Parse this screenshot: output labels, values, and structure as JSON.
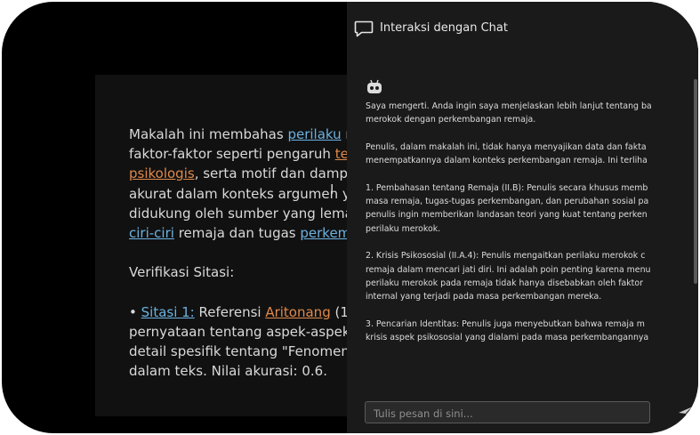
{
  "document": {
    "lines": [
      [
        {
          "t": "Makalah ini membahas ",
          "s": "plain"
        },
        {
          "t": "perilaku",
          "s": "blue"
        },
        {
          "t": " me",
          "s": "plain"
        }
      ],
      [
        {
          "t": "faktor-faktor seperti pengaruh ",
          "s": "plain"
        },
        {
          "t": "tem",
          "s": "orange"
        }
      ],
      [
        {
          "t": "psikologis",
          "s": "orange"
        },
        {
          "t": ", serta motif dan dampak",
          "s": "plain"
        }
      ],
      [
        {
          "t": "akurat dalam konteks argumen yan",
          "s": "plain"
        }
      ],
      [
        {
          "t": "didukung oleh sumber yang lemah.",
          "s": "plain"
        }
      ],
      [
        {
          "t": "ciri-ciri",
          "s": "blue"
        },
        {
          "t": " remaja dan tugas ",
          "s": "plain"
        },
        {
          "t": "perkemba",
          "s": "blue"
        }
      ],
      [],
      [
        {
          "t": "Verifikasi Sitasi:",
          "s": "plain"
        }
      ],
      [],
      [
        {
          "t": "• ",
          "s": "plain"
        },
        {
          "t": "Sitasi 1:",
          "s": "blue"
        },
        {
          "t": " Referensi ",
          "s": "plain"
        },
        {
          "t": "Aritonang",
          "s": "orange"
        },
        {
          "t": " (199",
          "s": "plain"
        }
      ],
      [
        {
          "t": "pernyataan tentang aspek-aspek pe",
          "s": "plain"
        }
      ],
      [
        {
          "t": "detail spesifik tentang \"Fenomena '",
          "s": "plain"
        }
      ],
      [
        {
          "t": "dalam teks. Nilai akurasi: 0.6.",
          "s": "plain"
        }
      ]
    ]
  },
  "chat": {
    "title": "Interaksi dengan Chat",
    "header_icon": "chat-bubble-icon",
    "bot_icon": "robot-icon",
    "message_lines": [
      "Saya mengerti. Anda ingin saya menjelaskan lebih lanjut tentang ba",
      "merokok dengan perkembangan remaja.",
      "",
      "Penulis, dalam makalah ini, tidak hanya menyajikan data dan fakta",
      "menempatkannya dalam konteks perkembangan remaja. Ini terliha",
      "",
      "1.  Pembahasan tentang Remaja (II.B): Penulis secara khusus memb",
      "masa remaja, tugas-tugas perkembangan, dan perubahan sosial pa",
      "penulis ingin memberikan landasan teori yang kuat tentang perken",
      "perilaku merokok.",
      "",
      "2.  Krisis Psikososial (II.A.4): Penulis mengaitkan perilaku merokok c",
      "remaja dalam mencari jati diri. Ini adalah poin penting karena menu",
      "perilaku merokok pada remaja tidak hanya disebabkan oleh faktor",
      "internal yang terjadi pada masa perkembangan mereka.",
      "",
      "3.  Pencarian Identitas: Penulis juga menyebutkan bahwa remaja m",
      "krisis aspek psikososial yang dialami pada masa perkembangannya"
    ],
    "input_placeholder": "Tulis pesan di sini...",
    "input_value": "",
    "send_icon": "send-icon"
  }
}
